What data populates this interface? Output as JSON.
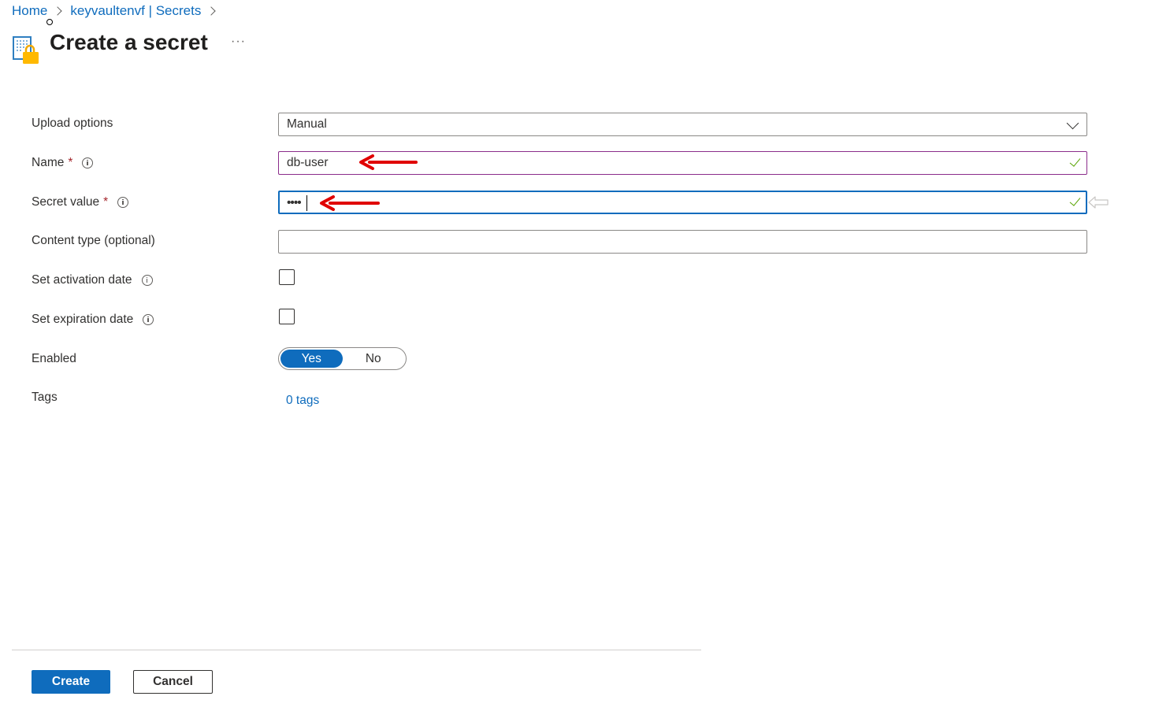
{
  "breadcrumb": {
    "items": [
      "Home",
      "keyvaultenvf | Secrets"
    ]
  },
  "header": {
    "title": "Create a secret",
    "more_label": "···"
  },
  "form": {
    "upload_options": {
      "label": "Upload options",
      "value": "Manual"
    },
    "name": {
      "label": "Name",
      "required_mark": "*",
      "value": "db-user",
      "valid": true
    },
    "secret_value": {
      "label": "Secret value",
      "required_mark": "*",
      "masked_value": "••••",
      "valid": true
    },
    "content_type": {
      "label": "Content type (optional)",
      "value": ""
    },
    "activation_date": {
      "label": "Set activation date",
      "checked": false
    },
    "expiration_date": {
      "label": "Set expiration date",
      "checked": false
    },
    "enabled": {
      "label": "Enabled",
      "options": [
        "Yes",
        "No"
      ],
      "selected": "Yes"
    },
    "tags": {
      "label": "Tags",
      "link_text": "0 tags"
    }
  },
  "footer": {
    "create_label": "Create",
    "cancel_label": "Cancel"
  },
  "colors": {
    "accent": "#0f6cbd",
    "required": "#a4262c",
    "valid_check": "#57a300",
    "annotation_arrow": "#e00000"
  },
  "icons": [
    "chevron-right-icon",
    "key-vault-secret-icon",
    "more-icon",
    "info-icon",
    "chevron-down-icon",
    "checkmark-icon"
  ]
}
